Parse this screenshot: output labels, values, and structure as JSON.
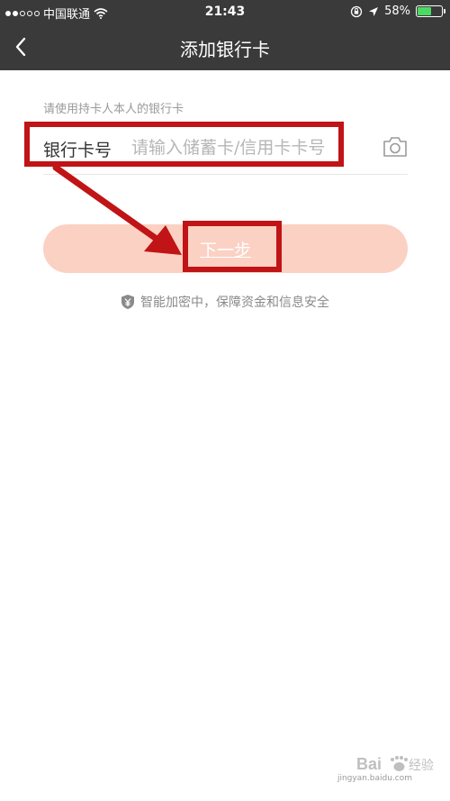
{
  "status_bar": {
    "carrier": "中国联通",
    "time": "21:43",
    "battery": "58%",
    "battery_level": 0.58,
    "signal_icon": "signal-dots-icon",
    "wifi_icon": "wifi-icon",
    "lock_icon": "rotation-lock-icon",
    "location_icon": "location-arrow-icon",
    "battery_icon": "battery-icon"
  },
  "nav": {
    "back_icon": "chevron-left-icon",
    "title": "添加银行卡"
  },
  "form": {
    "hint": "请使用持卡人本人的银行卡",
    "card_label": "银行卡号",
    "card_value": "",
    "card_placeholder": "请输入储蓄卡/信用卡卡号",
    "camera_icon": "camera-icon"
  },
  "next_button": {
    "label": "下一步"
  },
  "security_note": {
    "icon": "yen-shield-icon",
    "text": "智能加密中，保障资金和信息安全"
  },
  "watermark": {
    "text": "jingyan.baidu.com"
  },
  "colors": {
    "bar_bg": "#3a3a3a",
    "button_bg": "#fbd1c3",
    "annotation_red": "#c01416",
    "battery_green": "#4cd964"
  }
}
